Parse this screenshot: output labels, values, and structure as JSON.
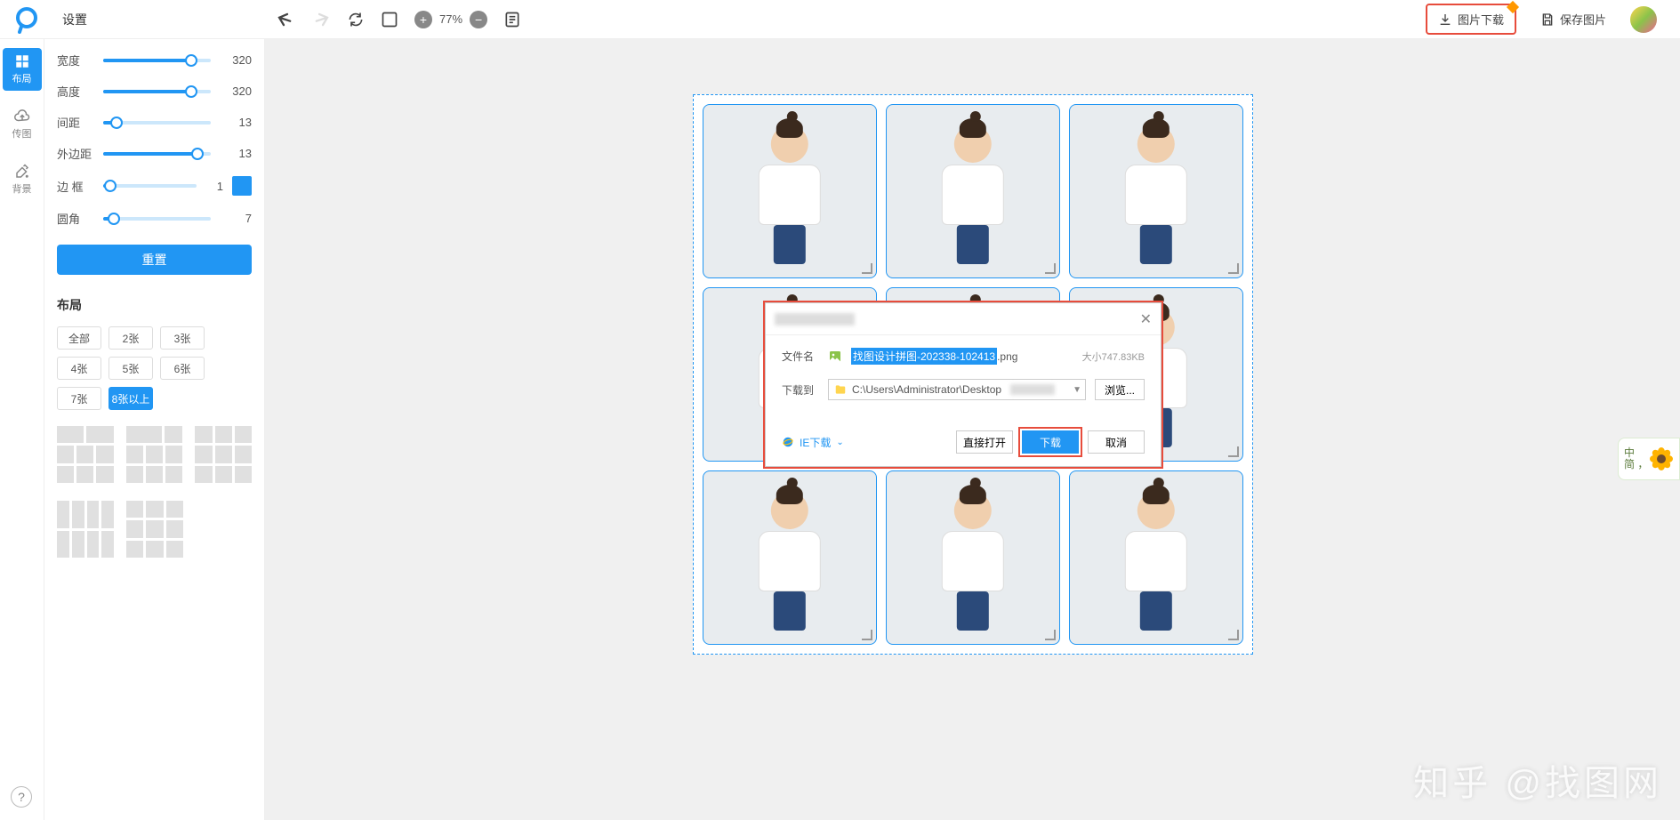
{
  "header": {
    "settings_label": "设置",
    "zoom_value": "77%",
    "download_label": "图片下载",
    "save_label": "保存图片"
  },
  "nav": {
    "layout": "布局",
    "upload": "传图",
    "background": "背景"
  },
  "panel": {
    "sliders": {
      "width_label": "宽度",
      "width_val": "320",
      "height_label": "高度",
      "height_val": "320",
      "gap_label": "间距",
      "gap_val": "13",
      "margin_label": "外边距",
      "margin_val": "13",
      "border_label": "边 框",
      "border_val": "1",
      "radius_label": "圆角",
      "radius_val": "7"
    },
    "reset_label": "重置",
    "layout_section": "布局",
    "counts": {
      "all": "全部",
      "c2": "2张",
      "c3": "3张",
      "c4": "4张",
      "c5": "5张",
      "c6": "6张",
      "c7": "7张",
      "c8plus": "8张以上"
    }
  },
  "dialog": {
    "filename_label": "文件名",
    "filename_selected": "找图设计拼图-202338-102413",
    "filename_ext": ".png",
    "filesize_label": "大小747.83KB",
    "saveto_label": "下载到",
    "path_value": "C:\\Users\\Administrator\\Desktop",
    "browse_label": "浏览...",
    "ie_label": "IE下载",
    "open_label": "直接打开",
    "download_label": "下载",
    "cancel_label": "取消"
  },
  "float": {
    "text1": "中",
    "text2": "简 ，"
  },
  "watermark": "知乎 @找图网",
  "colors": {
    "primary": "#2196f3",
    "highlight": "#e74c3c"
  }
}
